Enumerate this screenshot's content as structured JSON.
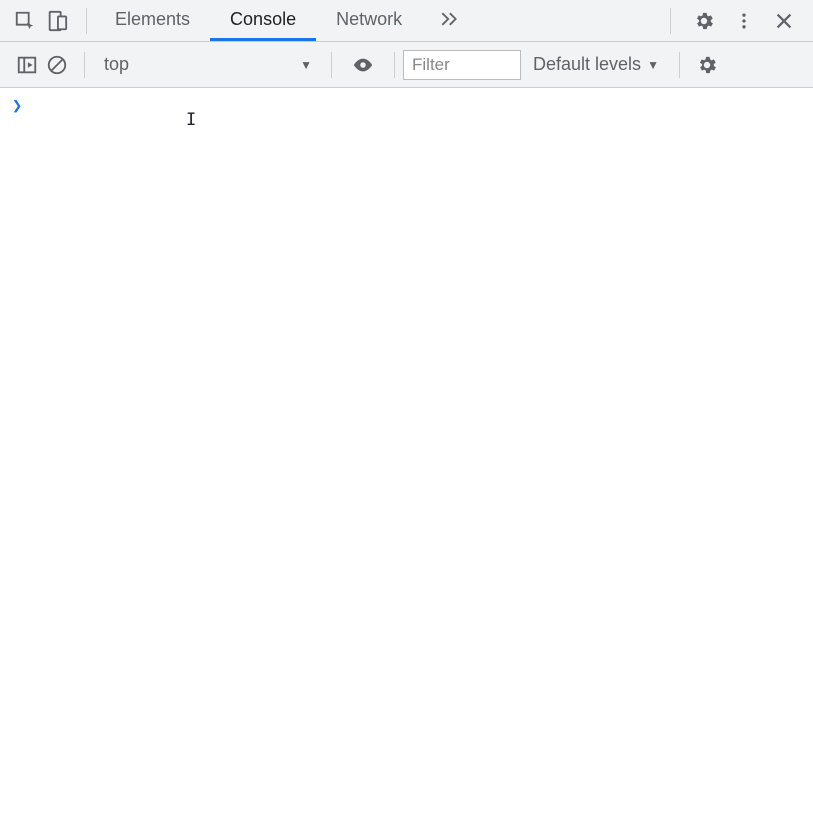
{
  "tabs": {
    "elements_label": "Elements",
    "console_label": "Console",
    "network_label": "Network"
  },
  "toolbar": {
    "context_selected": "top",
    "filter_placeholder": "Filter",
    "levels_label": "Default levels"
  },
  "console": {
    "prompt_symbol": "❯"
  }
}
